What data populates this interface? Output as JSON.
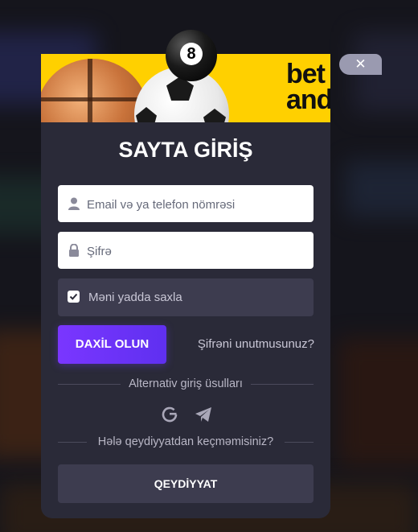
{
  "banner": {
    "logo_line1": "bet",
    "logo_line2": "andreas",
    "eight_ball_number": "8"
  },
  "close_button": {
    "label": "✕"
  },
  "login": {
    "title": "SAYTA GİRİŞ",
    "email_placeholder": "Email və ya telefon nömrəsi",
    "password_placeholder": "Şifrə",
    "remember_label": "Məni yadda saxla",
    "remember_checked": true,
    "submit_label": "DAXİL OLUN",
    "forgot_label": "Şifrəni unutmusunuz?"
  },
  "alternative": {
    "divider_text": "Alternativ giriş üsulları",
    "icons": [
      "google-icon",
      "telegram-icon"
    ]
  },
  "register": {
    "divider_text": "Hələ qeydiyyatdan keçməmisiniz?",
    "button_label": "QEYDİYYAT"
  },
  "colors": {
    "accent": "#6f33fb",
    "banner": "#ffd000",
    "modal_bg": "#2a2a38",
    "panel_bg": "#3d3c4f"
  }
}
